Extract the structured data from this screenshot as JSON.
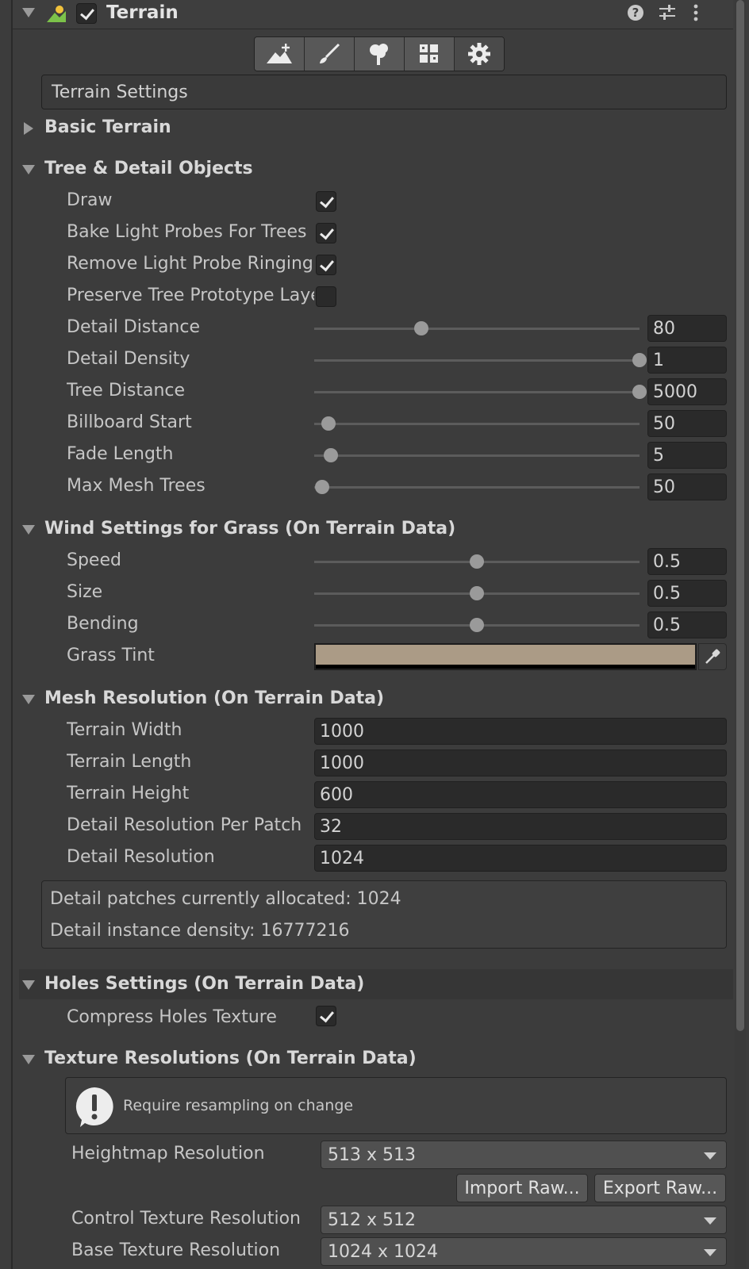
{
  "header": {
    "title": "Terrain",
    "terrain_enabled": true
  },
  "toolbar": {
    "tools": [
      {
        "name": "create-neighbor-terrains-tool",
        "icon": "mountain-plus-icon"
      },
      {
        "name": "paint-terrain-tool",
        "icon": "brush-icon"
      },
      {
        "name": "paint-trees-tool",
        "icon": "tree-icon"
      },
      {
        "name": "paint-details-tool",
        "icon": "grass-detail-icon"
      },
      {
        "name": "terrain-settings-tool",
        "icon": "gear-icon"
      }
    ]
  },
  "settings_header": {
    "label": "Terrain Settings"
  },
  "sections": {
    "basic_terrain": {
      "label": "Basic Terrain"
    },
    "tree_detail": {
      "label": "Tree & Detail Objects",
      "draw": {
        "label": "Draw",
        "checked": true
      },
      "bake_light_probes": {
        "label": "Bake Light Probes For Trees",
        "checked": true
      },
      "remove_ringing": {
        "label": "Remove Light Probe Ringing",
        "checked": true
      },
      "preserve_layers": {
        "label": "Preserve Tree Prototype Layers",
        "checked": false
      },
      "detail_distance": {
        "label": "Detail Distance",
        "value": "80",
        "fraction": 0.33
      },
      "detail_density": {
        "label": "Detail Density",
        "value": "1",
        "fraction": 1.0
      },
      "tree_distance": {
        "label": "Tree Distance",
        "value": "5000",
        "fraction": 1.0
      },
      "billboard_start": {
        "label": "Billboard Start",
        "value": "50",
        "fraction": 0.045
      },
      "fade_length": {
        "label": "Fade Length",
        "value": "5",
        "fraction": 0.05
      },
      "max_mesh_trees": {
        "label": "Max Mesh Trees",
        "value": "50",
        "fraction": 0.025
      }
    },
    "wind": {
      "label": "Wind Settings for Grass (On Terrain Data)",
      "speed": {
        "label": "Speed",
        "value": "0.5",
        "fraction": 0.5
      },
      "size": {
        "label": "Size",
        "value": "0.5",
        "fraction": 0.5
      },
      "bending": {
        "label": "Bending",
        "value": "0.5",
        "fraction": 0.5
      },
      "grass_tint": {
        "label": "Grass Tint",
        "color": "#ab9b86"
      }
    },
    "mesh_resolution": {
      "label": "Mesh Resolution (On Terrain Data)",
      "terrain_width": {
        "label": "Terrain Width",
        "value": "1000"
      },
      "terrain_length": {
        "label": "Terrain Length",
        "value": "1000"
      },
      "terrain_height": {
        "label": "Terrain Height",
        "value": "600"
      },
      "detail_res_per_patch": {
        "label": "Detail Resolution Per Patch",
        "value": "32"
      },
      "detail_resolution": {
        "label": "Detail Resolution",
        "value": "1024"
      },
      "info_line1": "Detail patches currently allocated: 1024",
      "info_line2": "Detail instance density: 16777216"
    },
    "holes": {
      "label": "Holes Settings (On Terrain Data)",
      "compress": {
        "label": "Compress Holes Texture",
        "checked": true
      }
    },
    "texture_res": {
      "label": "Texture Resolutions (On Terrain Data)",
      "warning": "Require resampling on change",
      "heightmap": {
        "label": "Heightmap Resolution",
        "value": "513 x 513"
      },
      "import_raw": "Import Raw...",
      "export_raw": "Export Raw...",
      "control": {
        "label": "Control Texture Resolution",
        "value": "512 x 512"
      },
      "base": {
        "label": "Base Texture Resolution",
        "value": "1024 x 1024"
      }
    }
  },
  "colors": {
    "background": "#3c3c3c",
    "field": "#2a2a2a",
    "accent_grass_tint": "#ab9b86"
  }
}
